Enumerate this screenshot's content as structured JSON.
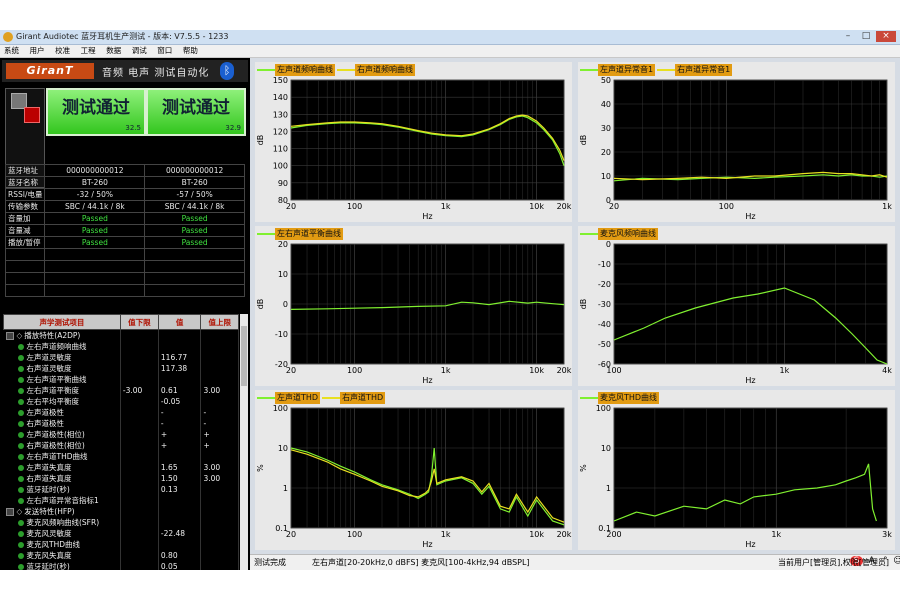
{
  "window": {
    "title": "Girant Audiotec 蓝牙耳机生产测试 - 版本: V7.5.5 - 1233",
    "controls": [
      "–",
      "□",
      "×"
    ]
  },
  "menu": [
    "系统",
    "用户",
    "校准",
    "工程",
    "数据",
    "调试",
    "窗口",
    "帮助"
  ],
  "brand": {
    "logo": "GiranT",
    "tagline": "音频 电声 测试自动化",
    "bluetooth_icon": "ᛒ"
  },
  "results": [
    {
      "label": "测试通过",
      "value": "32.5"
    },
    {
      "label": "测试通过",
      "value": "32.9"
    }
  ],
  "device_info": {
    "rows": [
      {
        "label": "蓝牙地址",
        "left": "000000000012",
        "right": "000000000012",
        "status": false
      },
      {
        "label": "蓝牙名称",
        "left": "BT-260",
        "right": "BT-260",
        "status": false
      },
      {
        "label": "RSSI/电量",
        "left": "-32 / 50%",
        "right": "-57 / 50%",
        "status": false
      },
      {
        "label": "传输参数",
        "left": "SBC / 44.1k / 8k",
        "right": "SBC / 44.1k / 8k",
        "status": false
      },
      {
        "label": "音量加",
        "left": "Passed",
        "right": "Passed",
        "status": true
      },
      {
        "label": "音量减",
        "left": "Passed",
        "right": "Passed",
        "status": true
      },
      {
        "label": "播放/暂停",
        "left": "Passed",
        "right": "Passed",
        "status": true
      },
      {
        "label": "",
        "left": "",
        "right": "",
        "status": false
      },
      {
        "label": "",
        "left": "",
        "right": "",
        "status": false
      },
      {
        "label": "",
        "left": "",
        "right": "",
        "status": false
      },
      {
        "label": "",
        "left": "",
        "right": "",
        "status": false
      }
    ]
  },
  "tests": {
    "headers": [
      "声学测试项目",
      "值下限",
      "值",
      "值上限"
    ],
    "rows": [
      {
        "kind": "group",
        "name": "播放特性(A2DP)",
        "low": "",
        "val": "",
        "high": ""
      },
      {
        "kind": "item",
        "name": "左右声道频响曲线",
        "low": "",
        "val": "",
        "high": ""
      },
      {
        "kind": "item",
        "name": "左声道灵敏度",
        "low": "",
        "val": "116.77",
        "high": ""
      },
      {
        "kind": "item",
        "name": "右声道灵敏度",
        "low": "",
        "val": "117.38",
        "high": ""
      },
      {
        "kind": "item",
        "name": "左右声道平衡曲线",
        "low": "",
        "val": "",
        "high": ""
      },
      {
        "kind": "item",
        "name": "左右声道平衡度",
        "low": "-3.00",
        "val": "0.61",
        "high": "3.00"
      },
      {
        "kind": "item",
        "name": "左右平均平衡度",
        "low": "",
        "val": "-0.05",
        "high": ""
      },
      {
        "kind": "item",
        "name": "左声道极性",
        "low": "",
        "val": "-",
        "high": "-"
      },
      {
        "kind": "item",
        "name": "右声道极性",
        "low": "",
        "val": "-",
        "high": "-"
      },
      {
        "kind": "item",
        "name": "左声道极性(相位)",
        "low": "",
        "val": "+",
        "high": "+"
      },
      {
        "kind": "item",
        "name": "右声道极性(相位)",
        "low": "",
        "val": "+",
        "high": "+"
      },
      {
        "kind": "item",
        "name": "左右声道THD曲线",
        "low": "",
        "val": "",
        "high": ""
      },
      {
        "kind": "item",
        "name": "左声道失真度",
        "low": "",
        "val": "1.65",
        "high": "3.00"
      },
      {
        "kind": "item",
        "name": "右声道失真度",
        "low": "",
        "val": "1.50",
        "high": "3.00"
      },
      {
        "kind": "item",
        "name": "蓝牙延时(秒)",
        "low": "",
        "val": "0.13",
        "high": ""
      },
      {
        "kind": "item",
        "name": "左右声道异常音指标1",
        "low": "",
        "val": "",
        "high": ""
      },
      {
        "kind": "group",
        "name": "发送特性(HFP)",
        "low": "",
        "val": "",
        "high": ""
      },
      {
        "kind": "item",
        "name": "麦克风频响曲线(SFR)",
        "low": "",
        "val": "",
        "high": ""
      },
      {
        "kind": "item",
        "name": "麦克风灵敏度",
        "low": "",
        "val": "-22.48",
        "high": ""
      },
      {
        "kind": "item",
        "name": "麦克风THD曲线",
        "low": "",
        "val": "",
        "high": ""
      },
      {
        "kind": "item",
        "name": "麦克风失真度",
        "low": "",
        "val": "0.80",
        "high": ""
      },
      {
        "kind": "item",
        "name": "蓝牙延时(秒)",
        "low": "",
        "val": "0.05",
        "high": ""
      }
    ]
  },
  "status": {
    "left": "测试完成",
    "center": "左右声道[20-20kHz,0 dBFS] 麦克风[100-4kHz,94 dBSPL]",
    "right": "当前用户[管理员],权限[管理员]",
    "tray_icons": [
      "S",
      "A",
      "·°",
      "☺",
      "🎤",
      "▦",
      "♟",
      "♜",
      "⚙"
    ]
  },
  "chart_data": [
    {
      "type": "line",
      "series": [
        {
          "name": "左声道频响曲线",
          "x": [
            20,
            30,
            50,
            70,
            100,
            150,
            200,
            300,
            500,
            700,
            1000,
            1500,
            2000,
            3000,
            4000,
            5000,
            6000,
            7000,
            8000,
            10000,
            12000,
            15000,
            18000,
            20000
          ],
          "values": [
            122,
            123.5,
            124.5,
            125,
            125,
            124.5,
            124,
            122.5,
            120,
            118.5,
            117.5,
            117,
            118,
            121,
            124,
            127,
            128.5,
            129,
            128,
            125,
            121,
            115,
            107,
            100
          ]
        },
        {
          "name": "右声道频响曲线",
          "x": [
            20,
            30,
            50,
            70,
            100,
            150,
            200,
            300,
            500,
            700,
            1000,
            1500,
            2000,
            3000,
            4000,
            5000,
            6000,
            7000,
            8000,
            10000,
            12000,
            15000,
            18000,
            20000
          ],
          "values": [
            123,
            124,
            125,
            125.5,
            125.5,
            125,
            124.5,
            123,
            120.5,
            119,
            118,
            117.5,
            118.5,
            121.5,
            124.5,
            127.5,
            129,
            129.5,
            129,
            126,
            122,
            116,
            109,
            103
          ]
        }
      ],
      "xlabel": "Hz",
      "ylabel": "dB",
      "xscale": "log",
      "xlim": [
        20,
        20000
      ],
      "ylim": [
        80,
        150
      ],
      "xticks": [
        "20",
        "100",
        "1k",
        "10k",
        "20k"
      ],
      "yticks": [
        "80",
        "90",
        "100",
        "110",
        "120",
        "130",
        "140",
        "150"
      ],
      "grid": true
    },
    {
      "type": "line",
      "series": [
        {
          "name": "左声道异常音1",
          "x": [
            20,
            30,
            50,
            70,
            100,
            150,
            200,
            300,
            400,
            500,
            600,
            700,
            800,
            900,
            1000
          ],
          "values": [
            8,
            9,
            8.5,
            9,
            9.5,
            9,
            9.5,
            10,
            10.5,
            10,
            10.5,
            10,
            10,
            9.5,
            10
          ]
        },
        {
          "name": "右声道异常音1",
          "x": [
            20,
            30,
            50,
            70,
            100,
            150,
            200,
            300,
            400,
            500,
            600,
            700,
            800,
            900,
            1000
          ],
          "values": [
            9,
            8.5,
            9,
            9.5,
            9,
            10,
            10,
            11,
            11.5,
            11,
            11,
            10.5,
            10,
            10.5,
            9.5
          ]
        }
      ],
      "xlabel": "Hz",
      "ylabel": "dB",
      "xscale": "log",
      "xlim": [
        20,
        1000
      ],
      "ylim": [
        0,
        50
      ],
      "xticks": [
        "20",
        "100",
        "1k"
      ],
      "yticks": [
        "0",
        "10",
        "20",
        "30",
        "40",
        "50"
      ],
      "grid": true
    },
    {
      "type": "line",
      "series": [
        {
          "name": "左右声道平衡曲线",
          "x": [
            20,
            50,
            100,
            200,
            500,
            1000,
            1500,
            2000,
            3000,
            5000,
            8000,
            10000,
            15000,
            20000
          ],
          "values": [
            -1.8,
            -1.6,
            -1.4,
            -1.2,
            -0.8,
            -0.6,
            0.6,
            0.4,
            -0.2,
            0.9,
            0.3,
            0.6,
            0.1,
            -0.2
          ]
        }
      ],
      "xlabel": "Hz",
      "ylabel": "dB",
      "xscale": "log",
      "xlim": [
        20,
        20000
      ],
      "ylim": [
        -20,
        20
      ],
      "xticks": [
        "20",
        "100",
        "1k",
        "10k",
        "20k"
      ],
      "yticks": [
        "-20",
        "-10",
        "0",
        "10",
        "20"
      ],
      "grid": true
    },
    {
      "type": "line",
      "series": [
        {
          "name": "麦克风频响曲线",
          "x": [
            100,
            150,
            200,
            300,
            500,
            700,
            1000,
            1500,
            2000,
            2500,
            3000,
            3500,
            4000
          ],
          "values": [
            -48,
            -42,
            -37,
            -32,
            -27,
            -25,
            -22,
            -28,
            -37,
            -45,
            -52,
            -58,
            -63
          ]
        }
      ],
      "xlabel": "Hz",
      "ylabel": "dB",
      "xscale": "log",
      "xlim": [
        100,
        4000
      ],
      "ylim": [
        -60,
        0
      ],
      "xticks": [
        "100",
        "1k",
        "4k"
      ],
      "yticks": [
        "-60",
        "-50",
        "-40",
        "-30",
        "-20",
        "-10",
        "0"
      ],
      "grid": true
    },
    {
      "type": "line",
      "series": [
        {
          "name": "左声道THD",
          "x": [
            20,
            30,
            50,
            70,
            100,
            150,
            200,
            300,
            400,
            500,
            600,
            650,
            700,
            750,
            800,
            1000,
            1500,
            2000,
            2500,
            3000,
            4000,
            5000,
            6000,
            8000,
            10000,
            15000,
            20000
          ],
          "values": [
            10,
            8,
            5,
            3.5,
            2.5,
            1.6,
            1.2,
            0.9,
            0.7,
            0.55,
            0.7,
            0.8,
            2,
            10,
            1.2,
            1.5,
            1.8,
            1.3,
            0.7,
            1.1,
            0.3,
            0.25,
            0.6,
            0.2,
            0.5,
            0.15,
            0.12
          ]
        },
        {
          "name": "右声道THD",
          "x": [
            20,
            30,
            50,
            70,
            100,
            150,
            200,
            300,
            400,
            500,
            600,
            650,
            700,
            750,
            800,
            1000,
            1500,
            2000,
            2500,
            3000,
            4000,
            5000,
            6000,
            8000,
            10000,
            15000,
            20000
          ],
          "values": [
            9,
            7,
            4.5,
            3,
            2.2,
            1.5,
            1.1,
            0.85,
            0.65,
            0.6,
            0.75,
            0.9,
            1.5,
            3,
            1.3,
            1.6,
            1.9,
            1.5,
            0.8,
            1.3,
            0.35,
            0.3,
            0.7,
            0.25,
            0.6,
            0.18,
            0.14
          ]
        }
      ],
      "xlabel": "Hz",
      "ylabel": "%",
      "xscale": "log",
      "yscale": "log",
      "xlim": [
        20,
        20000
      ],
      "ylim": [
        0.1,
        100
      ],
      "xticks": [
        "20",
        "100",
        "1k",
        "10k",
        "20k"
      ],
      "yticks": [
        "0.1",
        "1",
        "10",
        "100"
      ],
      "grid": true
    },
    {
      "type": "line",
      "series": [
        {
          "name": "麦克风THD曲线",
          "x": [
            200,
            250,
            300,
            400,
            500,
            600,
            700,
            800,
            1000,
            1200,
            1500,
            1800,
            2000,
            2200,
            2400,
            2500,
            2600,
            2700
          ],
          "values": [
            0.15,
            0.25,
            0.2,
            0.35,
            0.3,
            0.5,
            0.4,
            0.6,
            0.7,
            0.9,
            1.0,
            1.2,
            1.5,
            1.8,
            2.2,
            4,
            0.3,
            0.15
          ]
        }
      ],
      "xlabel": "Hz",
      "ylabel": "%",
      "xscale": "log",
      "yscale": "log",
      "xlim": [
        200,
        3000
      ],
      "ylim": [
        0.1,
        100
      ],
      "xticks": [
        "200",
        "1k",
        "3k"
      ],
      "yticks": [
        "0.1",
        "1",
        "10",
        "100"
      ],
      "grid": true
    }
  ]
}
